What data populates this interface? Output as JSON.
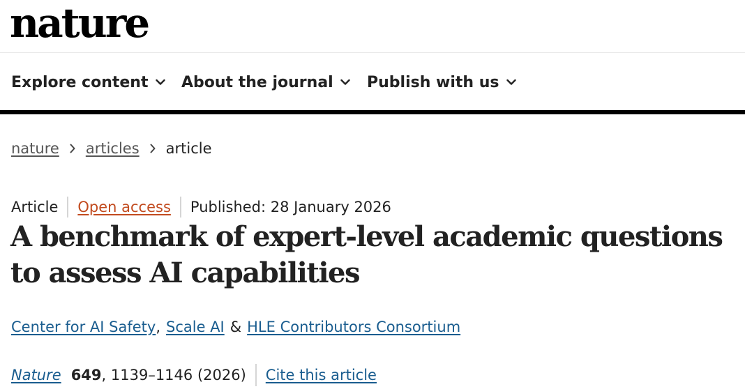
{
  "header": {
    "logo_text": "nature"
  },
  "nav": {
    "items": [
      {
        "label": "Explore content",
        "icon": "chevron-down-icon"
      },
      {
        "label": "About the journal",
        "icon": "chevron-down-icon"
      },
      {
        "label": "Publish with us",
        "icon": "chevron-down-icon"
      }
    ]
  },
  "breadcrumb": {
    "items": [
      "nature",
      "articles",
      "article"
    ],
    "separator_icon": "chevron-right-icon"
  },
  "article": {
    "type": "Article",
    "access": "Open access",
    "published": "Published: 28 January 2026",
    "title": "A benchmark of expert-level academic questions to assess AI capabilities",
    "authors": [
      {
        "name": "Center for AI Safety"
      },
      {
        "name": "Scale AI"
      },
      {
        "name": "HLE Contributors Consortium"
      }
    ],
    "author_sep_1": ",",
    "author_sep_2": "&",
    "citation": {
      "journal": "Nature",
      "volume": "649",
      "pages": ", 1139–1146 (2026)",
      "cite_link": "Cite this article"
    }
  },
  "colors": {
    "link_blue": "#1a5d8f",
    "open_access_orange": "#c24b1f",
    "text": "#222222",
    "nav_rule": "#000000"
  }
}
